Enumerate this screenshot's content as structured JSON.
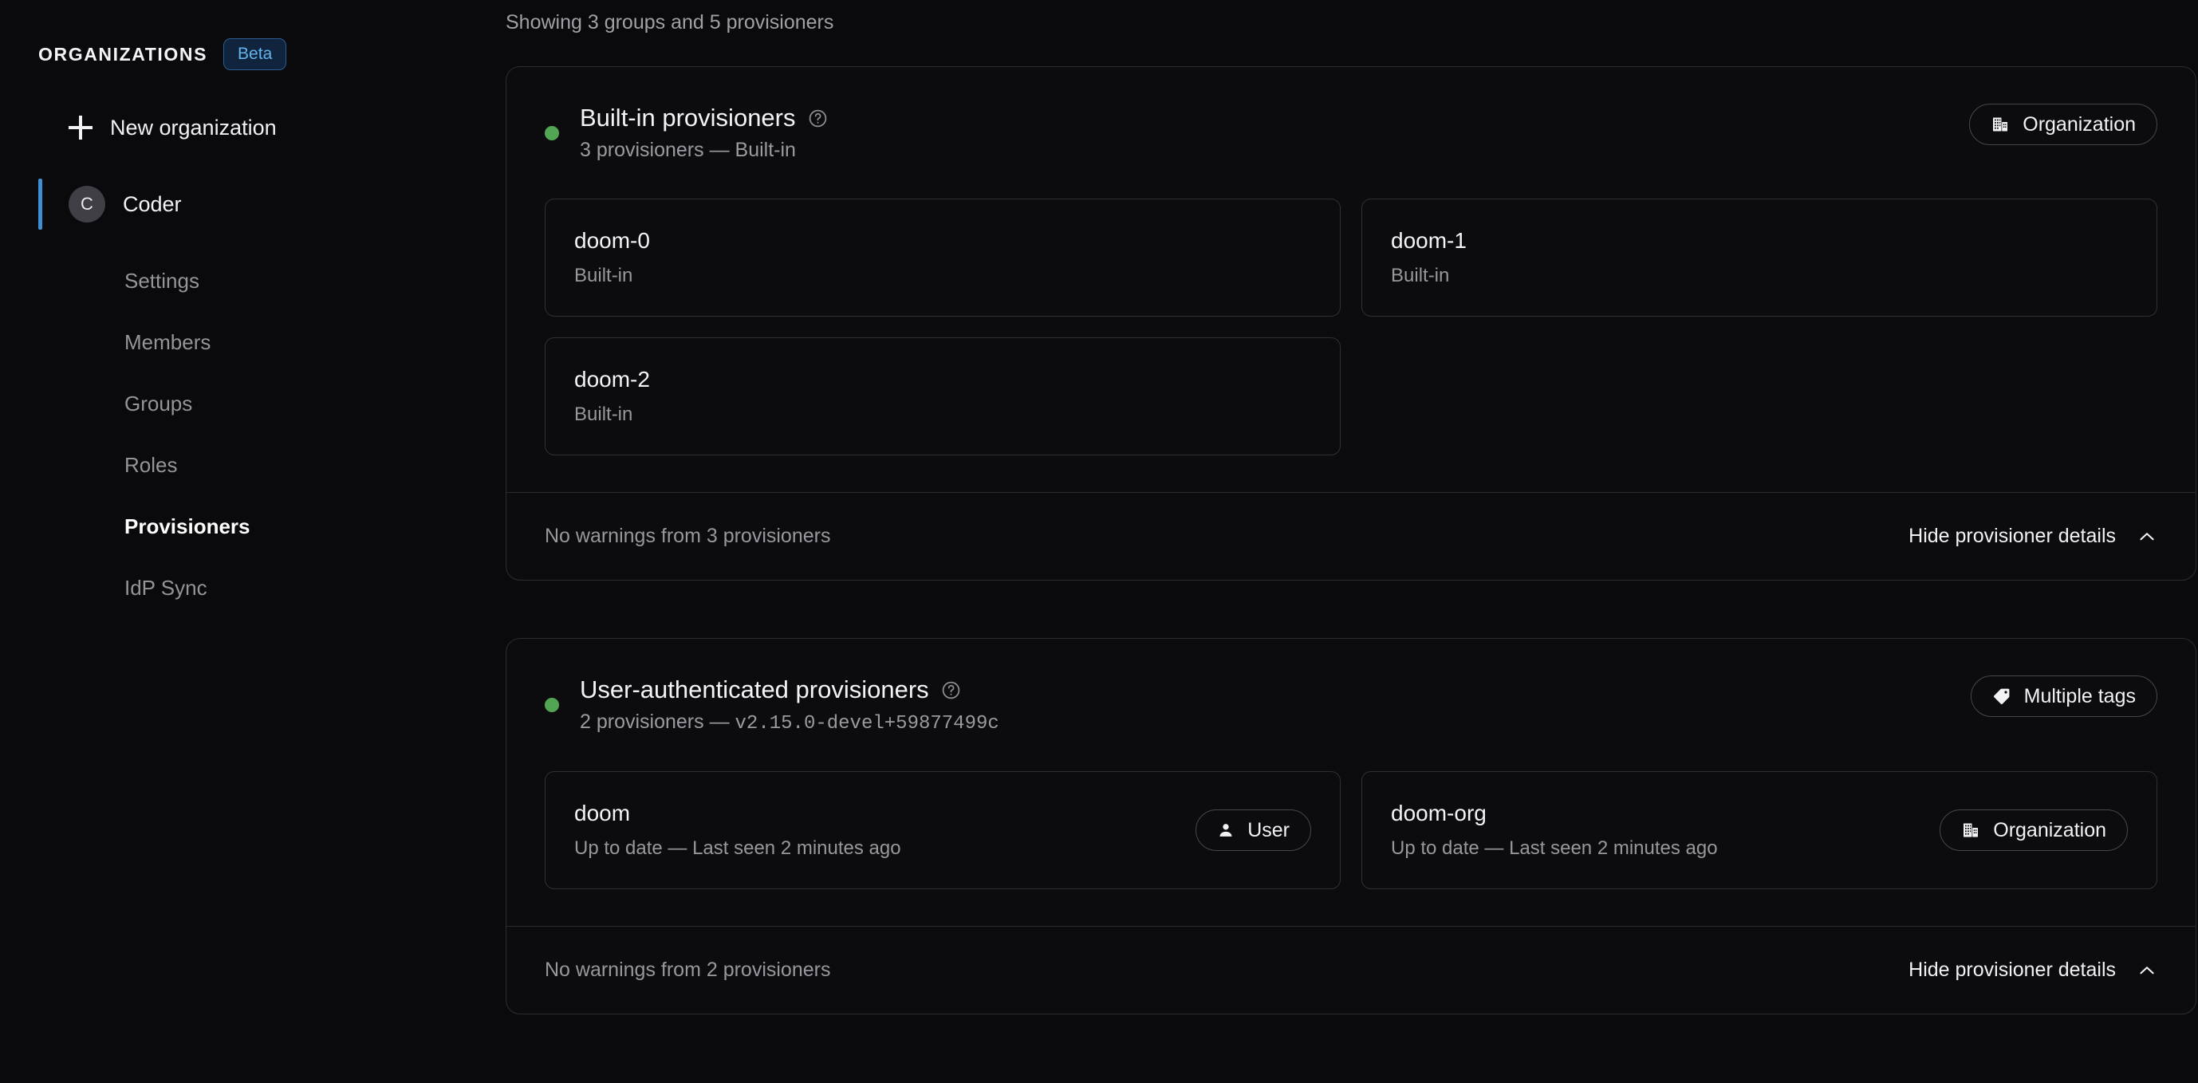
{
  "sidebar": {
    "section_title": "ORGANIZATIONS",
    "beta_badge": "Beta",
    "new_organization": "New organization",
    "org": {
      "initial": "C",
      "name": "Coder"
    },
    "nav_items": [
      {
        "label": "Settings",
        "active": false
      },
      {
        "label": "Members",
        "active": false
      },
      {
        "label": "Groups",
        "active": false
      },
      {
        "label": "Roles",
        "active": false
      },
      {
        "label": "Provisioners",
        "active": true
      },
      {
        "label": "IdP Sync",
        "active": false
      }
    ]
  },
  "main": {
    "showing_text": "Showing 3 groups and 5 provisioners",
    "groups": [
      {
        "status": "healthy",
        "title": "Built-in provisioners",
        "subtitle_prefix": "3 provisioners — ",
        "subtitle_value": "Built-in",
        "subtitle_mono": false,
        "badge": {
          "icon": "building-icon",
          "label": "Organization"
        },
        "provisioners": [
          {
            "name": "doom-0",
            "meta": "Built-in",
            "badge": null
          },
          {
            "name": "doom-1",
            "meta": "Built-in",
            "badge": null
          },
          {
            "name": "doom-2",
            "meta": "Built-in",
            "badge": null
          }
        ],
        "footer_warning": "No warnings from 3 provisioners",
        "footer_toggle": "Hide provisioner details"
      },
      {
        "status": "healthy",
        "title": "User-authenticated provisioners",
        "subtitle_prefix": "2 provisioners — ",
        "subtitle_value": "v2.15.0-devel+59877499c",
        "subtitle_mono": true,
        "badge": {
          "icon": "tag-icon",
          "label": "Multiple tags"
        },
        "provisioners": [
          {
            "name": "doom",
            "meta": "Up to date — Last seen 2 minutes ago",
            "badge": {
              "icon": "user-icon",
              "label": "User"
            }
          },
          {
            "name": "doom-org",
            "meta": "Up to date — Last seen 2 minutes ago",
            "badge": {
              "icon": "building-icon",
              "label": "Organization"
            }
          }
        ],
        "footer_warning": "No warnings from 2 provisioners",
        "footer_toggle": "Hide provisioner details"
      }
    ]
  },
  "colors": {
    "background": "#0a0a0c",
    "card_border": "#2c2c34",
    "status_green": "#52a552",
    "accent_blue": "#3d8fd6",
    "beta_text": "#63b3ed",
    "beta_bg": "#10253d"
  },
  "icons": {
    "plus": "plus-icon",
    "help": "help-circle-icon",
    "chevron_up": "chevron-up-icon"
  }
}
